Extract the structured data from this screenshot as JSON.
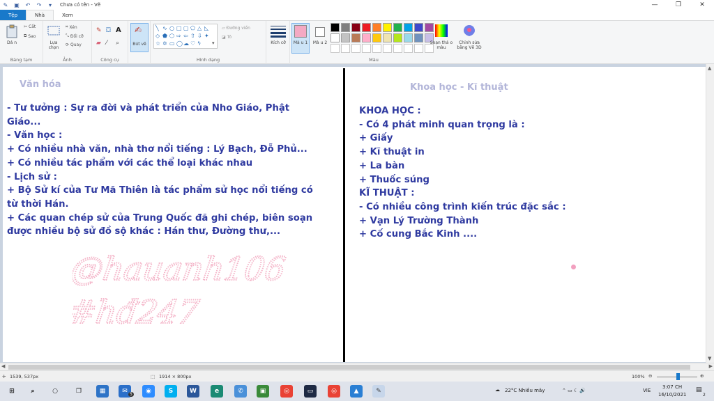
{
  "window": {
    "title": "Chưa có tên - Vẽ",
    "minimize_icon": "minimize-icon",
    "maximize_icon": "maximize-icon",
    "close_icon": "close-icon"
  },
  "tabs": [
    {
      "label": "Tệp"
    },
    {
      "label": "Nhà"
    },
    {
      "label": "Xem"
    }
  ],
  "ribbon": {
    "clipboard": {
      "paste": "Dá n",
      "cut": "Cắt",
      "copy": "Sao",
      "label": "Bảng tạm"
    },
    "image": {
      "select": "Lựa chọn",
      "crop": "Xén",
      "resize": "Đổi cỡ",
      "rotate": "Quay",
      "label": "Ảnh"
    },
    "tools": {
      "label": "Công cụ"
    },
    "brushes": {
      "label": "Bút vẽ"
    },
    "shapes": {
      "outline": "Đường viền",
      "fill": "Tô",
      "label": "Hình dạng"
    },
    "size": {
      "label": "Kích cỡ"
    },
    "colors": {
      "color1": "Mà u 1",
      "color2": "Mà u 2",
      "edit": "Soạn thả o màu",
      "paint3d": "Chỉnh sửa bằng Vẽ 3D",
      "label": "Màu",
      "palette_row1": [
        "#000000",
        "#7f7f7f",
        "#880015",
        "#ed1c24",
        "#ff7f27",
        "#fff200",
        "#22b14c",
        "#00a2e8",
        "#3f48cc",
        "#a349a4"
      ],
      "palette_row2": [
        "#ffffff",
        "#c3c3c3",
        "#b97a57",
        "#ffaec9",
        "#ffc90e",
        "#efe4b0",
        "#b5e61d",
        "#99d9ea",
        "#7092be",
        "#c8bfe7"
      ],
      "color1_value": "#f4a9c3",
      "color2_value": "#ffffff"
    }
  },
  "canvas": {
    "left_heading": "Văn hóa",
    "right_heading": "Khoa học - Kĩ thuật",
    "left_lines": [
      "- Tư tưởng : Sự ra đời và phát triển của Nho Giáo, Phật",
      "Giáo...",
      "- Văn học :",
      "+ Có nhiều nhà văn, nhà thơ nổi tiếng : Lý Bạch, Đỗ Phủ...",
      "+ Có nhiều tác phẩm với các thể loại khác nhau",
      "- Lịch sử :",
      "+ Bộ Sử kí của Tư Mã Thiên là tác phẩm sử học nổi tiếng có",
      "từ thời Hán.",
      "+ Các quan chép sử của Trung Quốc đã ghi chép, biên soạn",
      "được nhiều bộ sử đồ sộ khác : Hán thư, Đường thư,..."
    ],
    "right_lines": [
      "KHOA HỌC :",
      "- Có 4 phát minh quan trọng là :",
      "+ Giấy",
      "+ Kĩ thuật in",
      "+ La bàn",
      "+ Thuốc súng",
      "KĨ THUẬT :",
      "- Có nhiều công trình kiến trúc đặc sắc :",
      "+ Vạn Lý Trường Thành",
      "+ Cố cung Bắc Kinh ...."
    ],
    "watermark_line1": "@hauanh106",
    "watermark_line2": "#hđ247"
  },
  "status": {
    "cursor_pos": "1539, 537px",
    "image_size": "1914 × 800px",
    "zoom": "100%"
  },
  "taskbar": {
    "mail_badge": "5",
    "weather": "22°C  Nhiều mây",
    "lang": "VIE",
    "time": "3:07 CH",
    "date": "16/10/2021",
    "notif_count": "2"
  }
}
